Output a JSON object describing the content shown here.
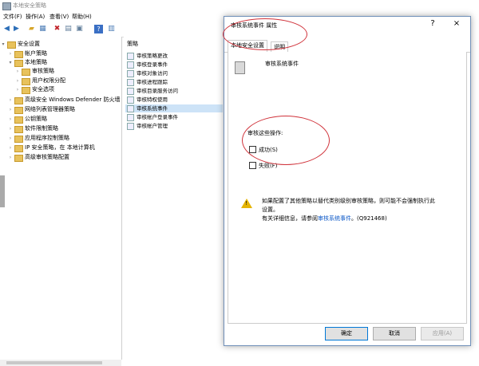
{
  "window": {
    "title": "本地安全策略"
  },
  "menu": [
    "文件(F)",
    "操作(A)",
    "查看(V)",
    "帮助(H)"
  ],
  "toolbar": [
    "back-icon",
    "forward-icon",
    "up-folder-icon",
    "show-hide-tree-icon",
    "delete-icon",
    "properties-icon",
    "export-icon",
    "help-icon",
    "snapin-icon"
  ],
  "tree": [
    {
      "label": "安全设置",
      "level": 0,
      "expanded": true
    },
    {
      "label": "帐户策略",
      "level": 1,
      "expanded": false
    },
    {
      "label": "本地策略",
      "level": 1,
      "expanded": true
    },
    {
      "label": "审核策略",
      "level": 2,
      "selected": true
    },
    {
      "label": "用户权限分配",
      "level": 2
    },
    {
      "label": "安全选项",
      "level": 2
    },
    {
      "label": "高级安全 Windows Defender 防火墙",
      "level": 1
    },
    {
      "label": "网络列表管理器策略",
      "level": 1
    },
    {
      "label": "公钥策略",
      "level": 1
    },
    {
      "label": "软件限制策略",
      "level": 1
    },
    {
      "label": "应用程序控制策略",
      "level": 1
    },
    {
      "label": "IP 安全策略，在 本地计算机",
      "level": 1
    },
    {
      "label": "高级审核策略配置",
      "level": 1
    }
  ],
  "list": {
    "header": "策略",
    "items": [
      "审核策略更改",
      "审核登录事件",
      "审核对象访问",
      "审核进程跟踪",
      "审核目录服务访问",
      "审核特权使用",
      "审核系统事件",
      "审核帐户登录事件",
      "审核帐户管理"
    ],
    "selected_index": 6
  },
  "dialog": {
    "title": "审核系统事件 属性",
    "help_glyph": "?",
    "close_glyph": "×",
    "tabs": [
      "本地安全设置",
      "说明"
    ],
    "policy_name": "审核系统事件",
    "audit_label": "审核这些操作:",
    "success_label": "成功(S)",
    "failure_label": "失败(F)",
    "success_checked": false,
    "failure_checked": false,
    "warning_line1": "如果配置了其他策略以替代类别级别审核策略，则可能不会强制执行此",
    "warning_line2": "设置。",
    "warning_line3_prefix": "有关详细信息，请参阅",
    "warning_link": "审核系统事件",
    "warning_line3_suffix": "。(Q921468)",
    "buttons": {
      "ok": "确定",
      "cancel": "取消",
      "apply": "应用(A)"
    }
  }
}
